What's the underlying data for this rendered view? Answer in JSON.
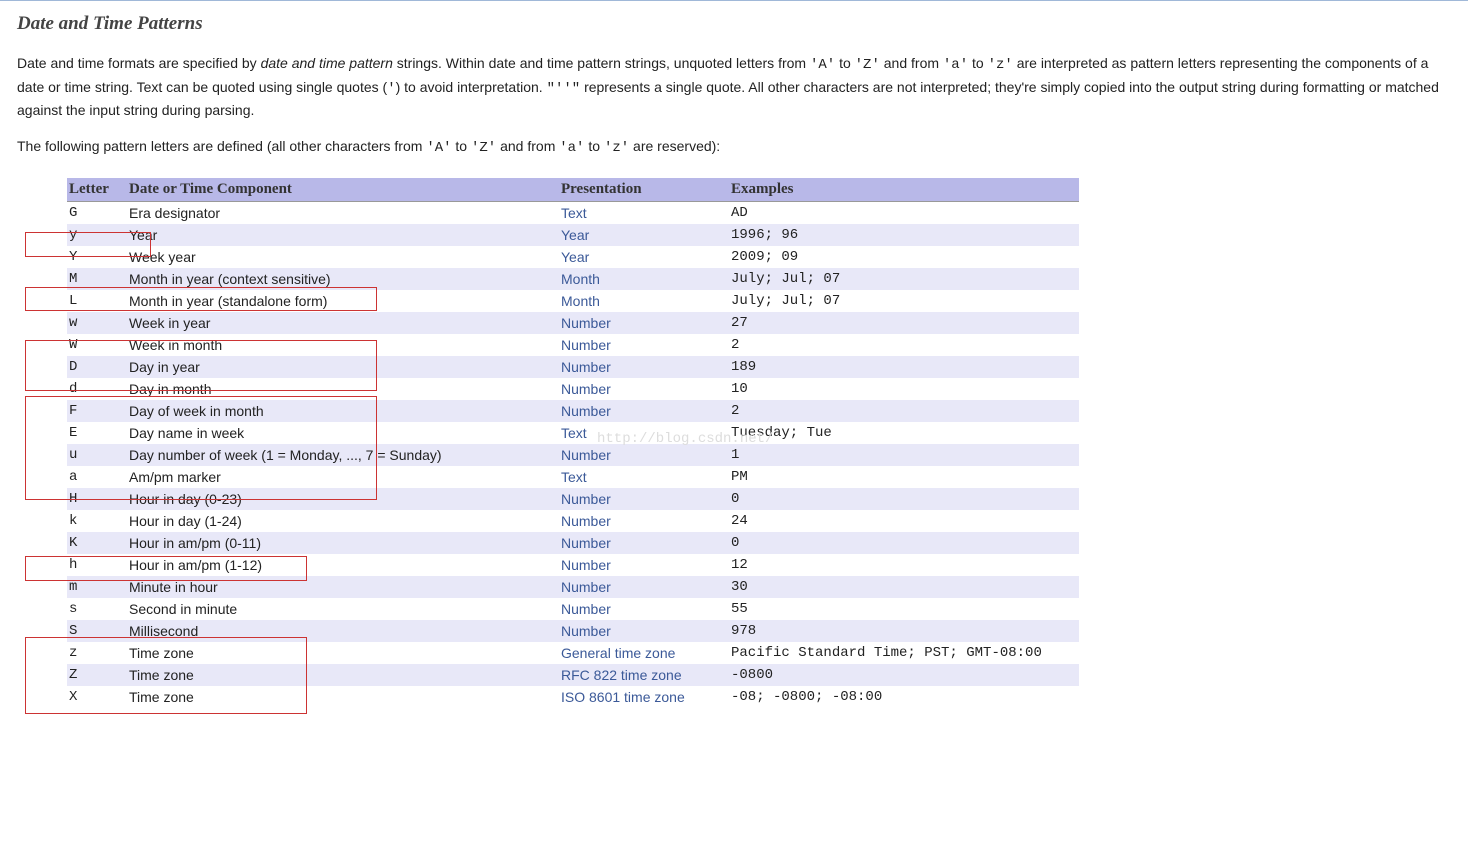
{
  "heading": "Date and Time Patterns",
  "para1_parts": {
    "p1": "Date and time formats are specified by ",
    "em": "date and time pattern",
    "p2": " strings. Within date and time pattern strings, unquoted letters from ",
    "c1": "'A'",
    "p3": " to ",
    "c2": "'Z'",
    "p4": " and from ",
    "c3": "'a'",
    "p5": " to ",
    "c4": "'z'",
    "p6": " are interpreted as pattern letters representing the components of a date or time string. Text can be quoted using single quotes (",
    "c5": "'",
    "p7": ") to avoid interpretation. ",
    "c6": "\"''\"",
    "p8": " represents a single quote. All other characters are not interpreted; they're simply copied into the output string during formatting or matched against the input string during parsing."
  },
  "para2_parts": {
    "p1": "The following pattern letters are defined (all other characters from ",
    "c1": "'A'",
    "p2": " to ",
    "c2": "'Z'",
    "p3": " and from ",
    "c3": "'a'",
    "p4": " to ",
    "c4": "'z'",
    "p5": " are reserved):"
  },
  "headers": {
    "letter": "Letter",
    "component": "Date or Time Component",
    "presentation": "Presentation",
    "examples": "Examples"
  },
  "rows": [
    {
      "letter": "G",
      "component": "Era designator",
      "presentation": "Text",
      "examples": "AD"
    },
    {
      "letter": "y",
      "component": "Year",
      "presentation": "Year",
      "examples": "1996; 96"
    },
    {
      "letter": "Y",
      "component": "Week year",
      "presentation": "Year",
      "examples": "2009; 09"
    },
    {
      "letter": "M",
      "component": "Month in year (context sensitive)",
      "presentation": "Month",
      "examples": "July; Jul; 07"
    },
    {
      "letter": "L",
      "component": "Month in year (standalone form)",
      "presentation": "Month",
      "examples": "July; Jul; 07"
    },
    {
      "letter": "w",
      "component": "Week in year",
      "presentation": "Number",
      "examples": "27"
    },
    {
      "letter": "W",
      "component": "Week in month",
      "presentation": "Number",
      "examples": "2"
    },
    {
      "letter": "D",
      "component": "Day in year",
      "presentation": "Number",
      "examples": "189"
    },
    {
      "letter": "d",
      "component": "Day in month",
      "presentation": "Number",
      "examples": "10"
    },
    {
      "letter": "F",
      "component": "Day of week in month",
      "presentation": "Number",
      "examples": "2"
    },
    {
      "letter": "E",
      "component": "Day name in week",
      "presentation": "Text",
      "examples": "Tuesday; Tue"
    },
    {
      "letter": "u",
      "component": "Day number of week (1 = Monday, ..., 7 = Sunday)",
      "presentation": "Number",
      "examples": "1"
    },
    {
      "letter": "a",
      "component": "Am/pm marker",
      "presentation": "Text",
      "examples": "PM"
    },
    {
      "letter": "H",
      "component": "Hour in day (0-23)",
      "presentation": "Number",
      "examples": "0"
    },
    {
      "letter": "k",
      "component": "Hour in day (1-24)",
      "presentation": "Number",
      "examples": "24"
    },
    {
      "letter": "K",
      "component": "Hour in am/pm (0-11)",
      "presentation": "Number",
      "examples": "0"
    },
    {
      "letter": "h",
      "component": "Hour in am/pm (1-12)",
      "presentation": "Number",
      "examples": "12"
    },
    {
      "letter": "m",
      "component": "Minute in hour",
      "presentation": "Number",
      "examples": "30"
    },
    {
      "letter": "s",
      "component": "Second in minute",
      "presentation": "Number",
      "examples": "55"
    },
    {
      "letter": "S",
      "component": "Millisecond",
      "presentation": "Number",
      "examples": "978"
    },
    {
      "letter": "z",
      "component": "Time zone",
      "presentation": "General time zone",
      "examples": "Pacific Standard Time; PST; GMT-08:00"
    },
    {
      "letter": "Z",
      "component": "Time zone",
      "presentation": "RFC 822 time zone",
      "examples": "-0800"
    },
    {
      "letter": "X",
      "component": "Time zone",
      "presentation": "ISO 8601 time zone",
      "examples": "-08; -0800; -08:00"
    }
  ],
  "watermark": "http://blog.csdn.net/"
}
